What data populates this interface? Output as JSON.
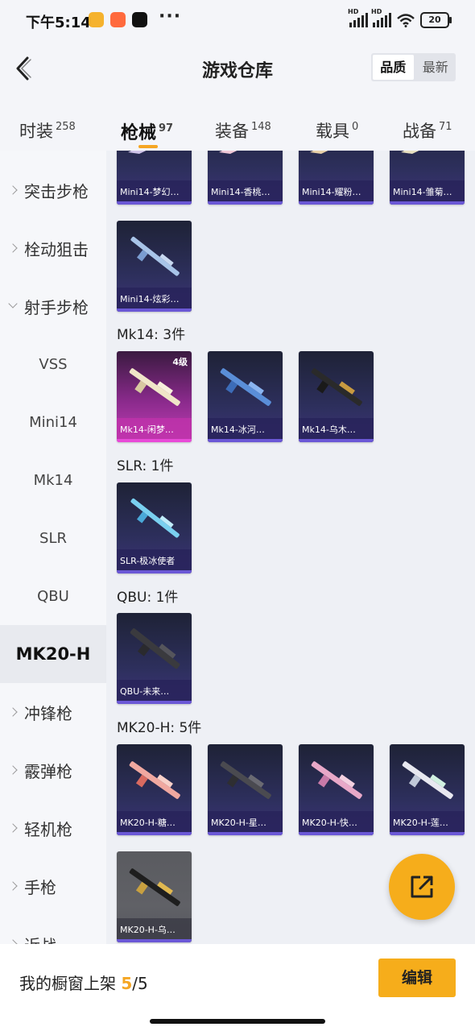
{
  "status": {
    "time": "下午5:14",
    "battery": "20"
  },
  "header": {
    "title": "游戏仓库",
    "sort": [
      "品质",
      "最新"
    ]
  },
  "tabs": [
    {
      "label": "时装",
      "count": "258"
    },
    {
      "label": "枪械",
      "count": "97"
    },
    {
      "label": "装备",
      "count": "148"
    },
    {
      "label": "载具",
      "count": "0"
    },
    {
      "label": "战备",
      "count": "71"
    }
  ],
  "sidebar": {
    "items": [
      "突击步枪",
      "栓动狙击",
      "射手步枪",
      "VSS",
      "Mini14",
      "Mk14",
      "SLR",
      "QBU",
      "MK20-H",
      "冲锋枪",
      "霰弹枪",
      "轻机枪",
      "手枪",
      "近战"
    ]
  },
  "sections": {
    "mini14_top": [
      "Mini14-梦幻…",
      "Mini14-香桃…",
      "Mini14-耀粉…",
      "Mini14-雏菊…"
    ],
    "mini14_last": "Mini14-炫彩…",
    "mk14": {
      "title": "Mk14: 3件",
      "items": [
        "Mk14-闲梦…",
        "Mk14-冰河…",
        "Mk14-乌木…"
      ],
      "level": "4级"
    },
    "slr": {
      "title": "SLR: 1件",
      "items": [
        "SLR-极冰使者"
      ]
    },
    "qbu": {
      "title": "QBU: 1件",
      "items": [
        "QBU-未来…"
      ]
    },
    "mk20": {
      "title": "MK20-H: 5件",
      "items": [
        "MK20-H-糖…",
        "MK20-H-星…",
        "MK20-H-快…",
        "MK20-H-莲…",
        "MK20-H-乌…"
      ]
    }
  },
  "bottom": {
    "shelf_label": "我的橱窗上架",
    "shelf_count": "5",
    "shelf_sep": "/",
    "shelf_total": "5",
    "edit": "编辑"
  },
  "colors": {
    "accent": "#f6ad1b",
    "card_purple": "#3c3478",
    "card_pink": "#c23fb5"
  }
}
